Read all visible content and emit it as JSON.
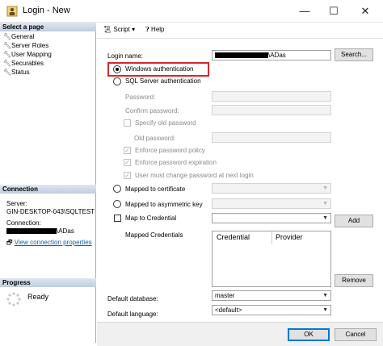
{
  "window": {
    "title": "Login - New",
    "minimize": "—",
    "maximize": "☐",
    "close": "✕"
  },
  "left": {
    "select_page_header": "Select a page",
    "pages": [
      "General",
      "Server Roles",
      "User Mapping",
      "Securables",
      "Status"
    ],
    "connection_header": "Connection",
    "server_label": "Server:",
    "server_value": "GIN-DESKTOP-043\\SQLTEST",
    "connection_label": "Connection:",
    "connection_value": "\\ADas",
    "view_props_link": "View connection properties",
    "progress_header": "Progress",
    "progress_status": "Ready"
  },
  "toolbar": {
    "script_label": "Script",
    "help_label": "Help"
  },
  "form": {
    "login_name_label": "Login name:",
    "login_name_value": "\\ADas",
    "search_button": "Search...",
    "windows_auth": "Windows authentication",
    "sql_auth": "SQL Server authentication",
    "password_label": "Password:",
    "confirm_password_label": "Confirm password:",
    "specify_old_password": "Specify old password",
    "old_password_label": "Old password:",
    "enforce_policy": "Enforce password policy",
    "enforce_expiration": "Enforce password expiration",
    "must_change": "User must change password at next login",
    "mapped_certificate": "Mapped to certificate",
    "mapped_asym_key": "Mapped to asymmetric key",
    "map_credential": "Map to Credential",
    "add_button": "Add",
    "mapped_credentials_label": "Mapped Credentials",
    "grid_col_credential": "Credential",
    "grid_col_provider": "Provider",
    "remove_button": "Remove",
    "default_database_label": "Default database:",
    "default_database_value": "master",
    "default_language_label": "Default language:",
    "default_language_value": "<default>"
  },
  "footer": {
    "ok_button": "OK",
    "cancel_button": "Cancel"
  }
}
